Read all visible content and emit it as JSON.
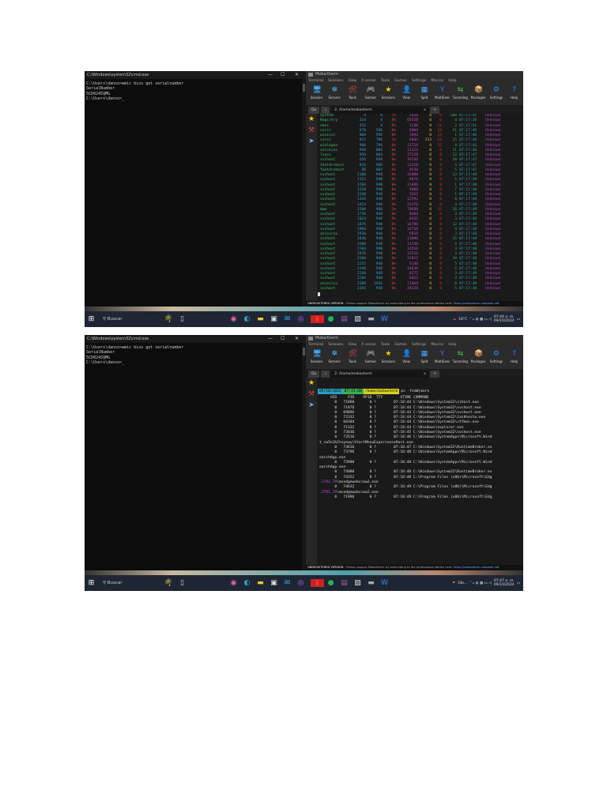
{
  "cmd": {
    "title": "C:\\Windows\\system32\\cmd.exe",
    "lines": [
      "C:\\Users\\danso>wmic bios get serialnumber",
      "SerialNumber",
      "5CD0245QMG",
      "",
      "C:\\Users\\danso>_"
    ]
  },
  "moba": {
    "title": "MobaXterm",
    "menu": [
      "Terminal",
      "Sessions",
      "View",
      "X server",
      "Tools",
      "Games",
      "Settings",
      "Macros",
      "Help"
    ],
    "toolbar": [
      {
        "label": "Session",
        "icon": "🖥"
      },
      {
        "label": "Servers",
        "icon": "✲"
      },
      {
        "label": "Tools",
        "icon": "🛠"
      },
      {
        "label": "Games",
        "icon": "🎮"
      },
      {
        "label": "Sessions",
        "icon": "★"
      },
      {
        "label": "View",
        "icon": "👤"
      },
      {
        "label": "Split",
        "icon": "▦"
      },
      {
        "label": "MultiExec",
        "icon": "Y"
      },
      {
        "label": "Tunneling",
        "icon": "⇆"
      },
      {
        "label": "Packages",
        "icon": "📦"
      },
      {
        "label": "Settings",
        "icon": "⚙"
      },
      {
        "label": "Help",
        "icon": "?"
      }
    ],
    "tab_label": "2. /home/mobaxterm",
    "quick_connect": "Qu",
    "unregistered": "UNREGISTERED VERSION",
    "support": " -  Please support MobaXterm by subscribing to the professional edition here: ",
    "link": "https://mobaxterm.mobatek.net"
  },
  "taskbar": {
    "search": "Buscar",
    "weather1": "18°C",
    "weather2": "Obr...",
    "time1": "07:44 a. m.",
    "time2": "07:47 a. m.",
    "date": "09/10/2024"
  },
  "top": {
    "rows": [
      [
        "System",
        "4",
        "0",
        "7%",
        "2620",
        "0",
        "0",
        "200",
        "07:17:41",
        "Unknown"
      ],
      [
        "Registry",
        "324",
        "4",
        "0%",
        "65528",
        "0",
        "0",
        "4",
        "07:17:38",
        "Unknown"
      ],
      [
        "smss",
        "432",
        "4",
        "0%",
        "1140",
        "0",
        "11",
        "2",
        "07:17:41",
        "Unknown"
      ],
      [
        "csrss",
        "676",
        "596",
        "0%",
        "6004",
        "0",
        "13",
        "11",
        "07:17:46",
        "Unknown"
      ],
      [
        "wininit",
        "804",
        "596",
        "0%",
        "7092",
        "0",
        "13",
        "1",
        "07:17:46",
        "Unknown"
      ],
      [
        "csrss",
        "812",
        "796",
        "1%",
        "6044",
        "213",
        "13",
        "15",
        "07:17:46",
        "Unknown"
      ],
      [
        "winlogon",
        "900",
        "796",
        "0%",
        "11716",
        "0",
        "12",
        "4",
        "07:17:46",
        "Unknown"
      ],
      [
        "services",
        "948",
        "804",
        "0%",
        "11112",
        "0",
        "0",
        "11",
        "07:17:46",
        "Unknown"
      ],
      [
        "lsass",
        "956",
        "804",
        "0%",
        "27228",
        "0",
        "0",
        "12",
        "07:17:47",
        "Unknown"
      ],
      [
        "svchost",
        "656",
        "948",
        "0%",
        "35236",
        "0",
        "0",
        "10",
        "07:17:47",
        "Unknown"
      ],
      [
        "fontdrvhost",
        "816",
        "900",
        "0%",
        "12428",
        "0",
        "0",
        "5",
        "07:17:47",
        "Unknown"
      ],
      [
        "fontdrvhost",
        "88",
        "804",
        "0%",
        "4936",
        "0",
        "0",
        "5",
        "07:17:47",
        "Unknown"
      ],
      [
        "svchost",
        "1108",
        "948",
        "0%",
        "16000",
        "0",
        "0",
        "13",
        "07:17:48",
        "Unknown"
      ],
      [
        "svchost",
        "1152",
        "948",
        "0%",
        "8876",
        "0",
        "0",
        "5",
        "07:17:48",
        "Unknown"
      ],
      [
        "svchost",
        "1204",
        "948",
        "0%",
        "11096",
        "0",
        "0",
        "1",
        "07:17:48",
        "Unknown"
      ],
      [
        "svchost",
        "1320",
        "948",
        "0%",
        "9008",
        "0",
        "0",
        "7",
        "07:17:48",
        "Unknown"
      ],
      [
        "svchost",
        "1340",
        "948",
        "0%",
        "5652",
        "0",
        "0",
        "1",
        "07:17:48",
        "Unknown"
      ],
      [
        "svchost",
        "1344",
        "948",
        "0%",
        "12592",
        "0",
        "0",
        "6",
        "07:17:48",
        "Unknown"
      ],
      [
        "svchost",
        "1424",
        "948",
        "0%",
        "22476",
        "0",
        "0",
        "4",
        "07:17:48",
        "Unknown"
      ],
      [
        "dwm",
        "1508",
        "900",
        "3%",
        "79688",
        "0",
        "13",
        "16",
        "07:17:48",
        "Unknown"
      ],
      [
        "svchost",
        "1736",
        "948",
        "0%",
        "8404",
        "0",
        "0",
        "3",
        "07:17:48",
        "Unknown"
      ],
      [
        "svchost",
        "1824",
        "948",
        "0%",
        "8432",
        "0",
        "0",
        "3",
        "07:17:48",
        "Unknown"
      ],
      [
        "svchost",
        "1876",
        "948",
        "0%",
        "16796",
        "0",
        "0",
        "12",
        "07:17:48",
        "Unknown"
      ],
      [
        "svchost",
        "1904",
        "948",
        "0%",
        "14728",
        "0",
        "0",
        "4",
        "07:17:48",
        "Unknown"
      ],
      [
        "atiesrxx",
        "1936",
        "948",
        "0%",
        "6816",
        "0",
        "0",
        "3",
        "07:17:48",
        "Unknown"
      ],
      [
        "svchost",
        "2036",
        "948",
        "0%",
        "11096",
        "0",
        "0",
        "15",
        "07:17:48",
        "Unknown"
      ],
      [
        "svchost",
        "1500",
        "948",
        "0%",
        "11736",
        "0",
        "0",
        "4",
        "07:17:48",
        "Unknown"
      ],
      [
        "svchost",
        "1704",
        "948",
        "0%",
        "14516",
        "0",
        "0",
        "3",
        "07:17:48",
        "Unknown"
      ],
      [
        "svchost",
        "2076",
        "948",
        "0%",
        "12516",
        "0",
        "0",
        "3",
        "07:17:48",
        "Unknown"
      ],
      [
        "svchost",
        "2200",
        "948",
        "0%",
        "11812",
        "0",
        "0",
        "19",
        "07:17:48",
        "Unknown"
      ],
      [
        "svchost",
        "2232",
        "948",
        "0%",
        "6140",
        "0",
        "0",
        "5",
        "07:17:48",
        "Unknown"
      ],
      [
        "svchost",
        "2240",
        "948",
        "0%",
        "14636",
        "0",
        "0",
        "5",
        "07:17:48",
        "Unknown"
      ],
      [
        "svchost",
        "2248",
        "948",
        "0%",
        "8272",
        "0",
        "0",
        "3",
        "07:17:48",
        "Unknown"
      ],
      [
        "svchost",
        "2284",
        "948",
        "0%",
        "6412",
        "0",
        "0",
        "3",
        "07:17:48",
        "Unknown"
      ],
      [
        "atieclxx",
        "2388",
        "1936",
        "0%",
        "11064",
        "0",
        "0",
        "8",
        "07:17:48",
        "Unknown"
      ],
      [
        "svchost",
        "2392",
        "948",
        "0%",
        "24220",
        "0",
        "0",
        "5",
        "07:17:48",
        "Unknown"
      ]
    ]
  },
  "ps": {
    "prompt_date": "09/10/2024",
    "prompt_time": "07:41:08",
    "prompt_path": "/home/mobaxterm",
    "command": "ps -feaW|more",
    "lines": [
      {
        "t": "     UID     PID    PPID  TTY        STIME COMMAND"
      },
      {
        "t": "       0   71860       0 ?        07:18:44 C:\\Windows\\System32\\sihost.exe"
      },
      {
        "t": "       0   71876       0 ?        07:18:44 C:\\Windows\\System32\\svchost.exe"
      },
      {
        "t": "       0   69096       0 ?        07:18:44 C:\\Windows\\System32\\svchost.exe"
      },
      {
        "t": "       0   72332       0 ?        07:18:44 C:\\Windows\\System32\\taskhostw.exe"
      },
      {
        "t": "       0   68304       0 ?        07:18:44 C:\\Windows\\System32\\ctfmon.exe"
      },
      {
        "t": "       0   71332       0 ?        07:18:44 C:\\Windows\\explorer.exe"
      },
      {
        "t": "       0   73036       0 ?        07:18:45 C:\\Windows\\System32\\svchost.exe"
      },
      {
        "t": "       0   73516       0 ?        07:18:46 C:\\Windows\\SystemApps\\Microsoft.Wind"
      },
      {
        "t": "t_cw5n1h2txyewy\\StartMenuExperienceHost.exe"
      },
      {
        "t": "       0   73616       0 ?        07:18:47 C:\\Windows\\System32\\RuntimeBroker.ex"
      },
      {
        "t": "       0   73796       0 ?        07:18:48 C:\\Windows\\SystemApps\\Microsoft.Wind"
      },
      {
        "t": "earchApp.exe"
      },
      {
        "t": "       0   73988       0 ?        07:18:48 C:\\Windows\\SystemApps\\Microsoft.Wind"
      },
      {
        "t": "earchApp.exe"
      },
      {
        "t": "       0   74080       0 ?        07:18:48 C:\\Windows\\System32\\RuntimeBroker.ex"
      },
      {
        "t": "       0   74352       0 ?        07:18:48 C:\\Program Files (x86)\\Microsoft\\Edg"
      },
      {
        "h": ".2792.79",
        "t": "\\msedgewebview2.exe"
      },
      {
        "t": "       0   74632       0 ?        07:18:49 C:\\Program Files (x86)\\Microsoft\\Edg"
      },
      {
        "h": ".2792.79",
        "t": "\\msedgewebview2.exe"
      },
      {
        "t": "       0   71996       0 ?        07:18:49 C:\\Program Files (x86)\\Microsoft\\Edg"
      }
    ]
  }
}
